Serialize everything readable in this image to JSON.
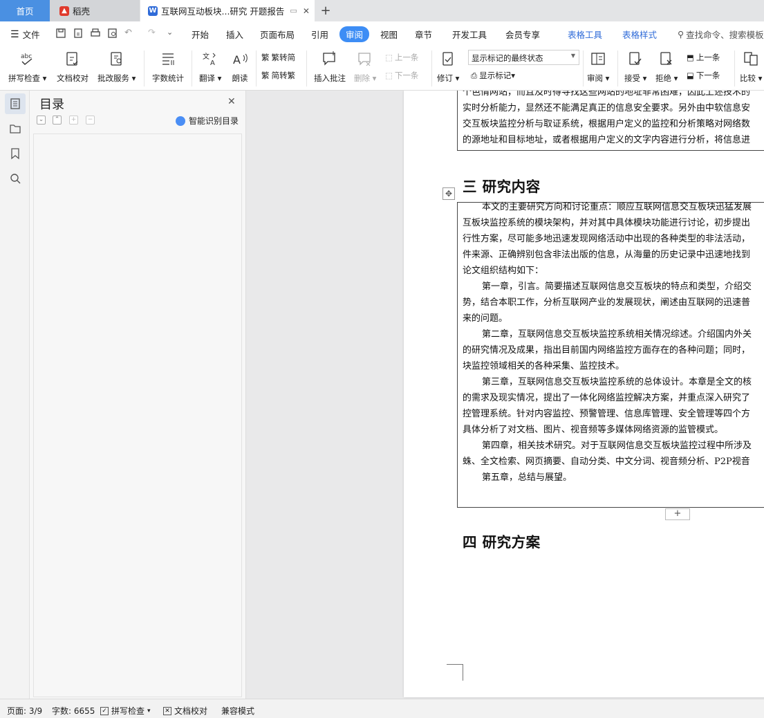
{
  "tabs": {
    "home": "首页",
    "daoke": "稻壳",
    "doc": "互联网互动板块...研究 开题报告",
    "new_tab": "+"
  },
  "menu": {
    "file": "文件",
    "items": [
      "开始",
      "插入",
      "页面布局",
      "引用",
      "审阅",
      "视图",
      "章节",
      "开发工具",
      "会员专享"
    ],
    "active": "审阅",
    "context_items": [
      "表格工具",
      "表格样式"
    ],
    "search": "查找命令、搜索模板"
  },
  "ribbon": {
    "spellcheck": "拼写检查",
    "doc_check": "文档校对",
    "review_service": "批改服务",
    "word_count": "字数统计",
    "translate": "翻译",
    "read_aloud": "朗读",
    "trad_to_simp": "繁转简",
    "simp_to_trad": "简转繁",
    "insert_comment": "插入批注",
    "delete": "删除",
    "prev": "上一条",
    "next": "下一条",
    "track_changes": "修订",
    "markup_state": "显示标记的最终状态",
    "show_markup": "显示标记",
    "review": "审阅",
    "accept": "接受",
    "reject": "拒绝",
    "prev2": "上一条",
    "next2": "下一条",
    "compare": "比较"
  },
  "toc": {
    "title": "目录",
    "close": "✕",
    "ai_label": "智能识别目录"
  },
  "document": {
    "top_box_lines": [
      "个色情网站，而且及时得寻找这些网站的地址非常困难，因此上述技术的",
      "实时分析能力，显然还不能满足真正的信息安全要求。另外由中软信息安",
      "交互板块监控分析与取证系统，根据用户定义的监控和分析策略对网络数",
      "的源地址和目标地址，或者根据用户定义的文字内容进行分析，将信息进"
    ],
    "heading3": "三 研究内容",
    "main_lines": [
      {
        "indent": true,
        "text": "本文的主要研究方向和讨论重点：顺应互联网信息交互板块迅猛发展"
      },
      {
        "indent": false,
        "text": "互板块监控系统的模块架构，并对其中具体模块功能进行讨论，初步提出"
      },
      {
        "indent": false,
        "text": "行性方案，尽可能多地迅速发现网络活动中出现的各种类型的非法活动，"
      },
      {
        "indent": false,
        "text": "件来源、正确辨别包含非法出版的信息，从海量的历史记录中迅速地找到"
      },
      {
        "indent": false,
        "text": "论文组织结构如下："
      },
      {
        "indent": true,
        "text": "第一章，引言。简要描述互联网信息交互板块的特点和类型，介绍交"
      },
      {
        "indent": false,
        "text": "势，结合本职工作，分析互联网产业的发展现状，阐述由互联网的迅速普"
      },
      {
        "indent": false,
        "text": "来的问题。"
      },
      {
        "indent": true,
        "text": "第二章，互联网信息交互板块监控系统相关情况综述。介绍国内外关"
      },
      {
        "indent": false,
        "text": "的研究情况及成果，指出目前国内网络监控方面存在的各种问题；同时，"
      },
      {
        "indent": false,
        "text": "块监控领域相关的各种采集、监控技术。"
      },
      {
        "indent": true,
        "text": "第三章，互联网信息交互板块监控系统的总体设计。本章是全文的核"
      },
      {
        "indent": false,
        "text": "的需求及现实情况，提出了一体化网络监控解决方案，并重点深入研究了"
      },
      {
        "indent": false,
        "text": "控管理系统。针对内容监控、预警管理、信息库管理、安全管理等四个方"
      },
      {
        "indent": false,
        "text": "具体分析了对文档、图片、视音频等多媒体网络资源的监管模式。"
      },
      {
        "indent": true,
        "text": "第四章，相关技术研究。对于互联网信息交互板块监控过程中所涉及"
      },
      {
        "indent": false,
        "text": "蛛、全文检索、网页摘要、自动分类、中文分词、视音频分析、P2P视音"
      },
      {
        "indent": true,
        "text": "第五章，总结与展望。"
      }
    ],
    "heading4": "四 研究方案",
    "add_row": "+"
  },
  "status": {
    "page": "页面: 3/9",
    "word_count": "字数: 6655",
    "spellcheck": "拼写检查",
    "doc_check": "文档校对",
    "compat": "兼容模式"
  },
  "colors": {
    "accent": "#3d8df5",
    "home_tab": "#4a90e2",
    "context_tab": "#2f6bd8"
  }
}
